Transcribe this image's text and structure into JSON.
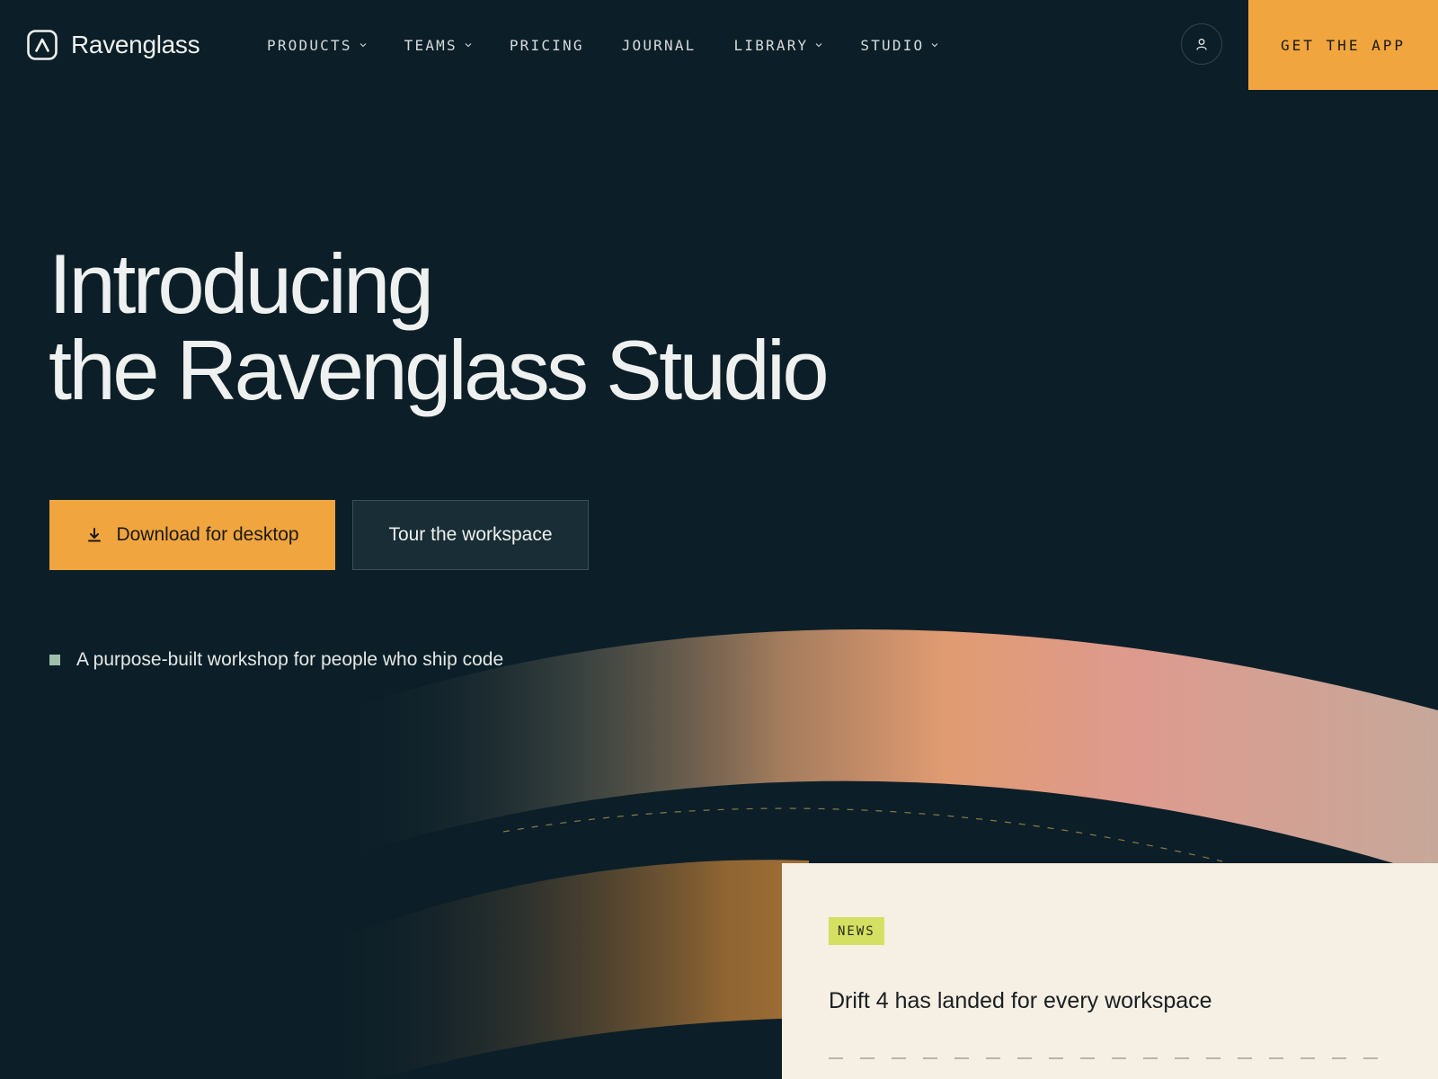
{
  "brand": {
    "name": "Ravenglass"
  },
  "nav": {
    "items": [
      {
        "label": "PRODUCTS",
        "dropdown": true
      },
      {
        "label": "TEAMS",
        "dropdown": true
      },
      {
        "label": "PRICING",
        "dropdown": false
      },
      {
        "label": "JOURNAL",
        "dropdown": false
      },
      {
        "label": "LIBRARY",
        "dropdown": true
      },
      {
        "label": "STUDIO",
        "dropdown": true
      }
    ],
    "account_icon": "user-icon",
    "cta_label": "GET THE APP"
  },
  "hero": {
    "title_line1": "Introducing",
    "title_line2": "the Ravenglass Studio",
    "primary_button": {
      "label": "Download for desktop",
      "icon": "download-icon"
    },
    "secondary_button": {
      "label": "Tour the workspace"
    },
    "tagline": "A purpose-built workshop for people who ship code"
  },
  "news": {
    "badge": "NEWS",
    "title": "Drift 4 has landed for every workspace"
  },
  "colors": {
    "background": "#0c1f28",
    "accent": "#f0a53f",
    "badge": "#d3e062",
    "card": "#f6efe3",
    "bullet": "#9fc0ac"
  }
}
